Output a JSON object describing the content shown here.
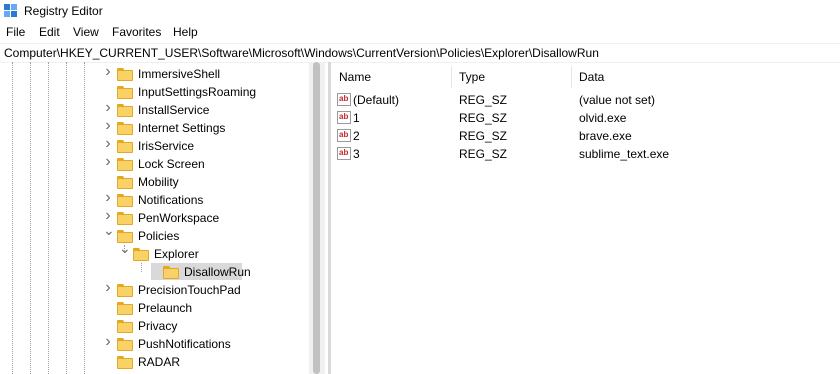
{
  "window": {
    "title": "Registry Editor",
    "icon": "registry-editor-icon"
  },
  "menu": [
    "File",
    "Edit",
    "View",
    "Favorites",
    "Help"
  ],
  "address": "Computer\\HKEY_CURRENT_USER\\Software\\Microsoft\\Windows\\CurrentVersion\\Policies\\Explorer\\DisallowRun",
  "tree": {
    "items": [
      {
        "label": "ImmersiveShell",
        "expander": "collapsed"
      },
      {
        "label": "InputSettingsRoaming",
        "expander": "none"
      },
      {
        "label": "InstallService",
        "expander": "collapsed"
      },
      {
        "label": "Internet Settings",
        "expander": "collapsed"
      },
      {
        "label": "IrisService",
        "expander": "collapsed"
      },
      {
        "label": "Lock Screen",
        "expander": "collapsed"
      },
      {
        "label": "Mobility",
        "expander": "none"
      },
      {
        "label": "Notifications",
        "expander": "collapsed"
      },
      {
        "label": "PenWorkspace",
        "expander": "collapsed"
      },
      {
        "label": "Policies",
        "expander": "expanded"
      },
      {
        "label": "Explorer",
        "expander": "expanded"
      },
      {
        "label": "DisallowRun",
        "expander": "none",
        "selected": true
      },
      {
        "label": "PrecisionTouchPad",
        "expander": "collapsed"
      },
      {
        "label": "Prelaunch",
        "expander": "none"
      },
      {
        "label": "Privacy",
        "expander": "none"
      },
      {
        "label": "PushNotifications",
        "expander": "collapsed"
      },
      {
        "label": "RADAR",
        "expander": "none"
      }
    ]
  },
  "list": {
    "headers": {
      "name": "Name",
      "type": "Type",
      "data": "Data"
    },
    "rows": [
      {
        "name": "(Default)",
        "type": "REG_SZ",
        "data": "(value not set)",
        "icon": "string-value-icon"
      },
      {
        "name": "1",
        "type": "REG_SZ",
        "data": "olvid.exe",
        "icon": "string-value-icon"
      },
      {
        "name": "2",
        "type": "REG_SZ",
        "data": "brave.exe",
        "icon": "string-value-icon"
      },
      {
        "name": "3",
        "type": "REG_SZ",
        "data": "sublime_text.exe",
        "icon": "string-value-icon"
      }
    ],
    "icon_glyph": "ab"
  },
  "colors": {
    "selection": "#d9d9d9",
    "folder": "#f8d267",
    "value_icon_text": "#c1272d"
  }
}
